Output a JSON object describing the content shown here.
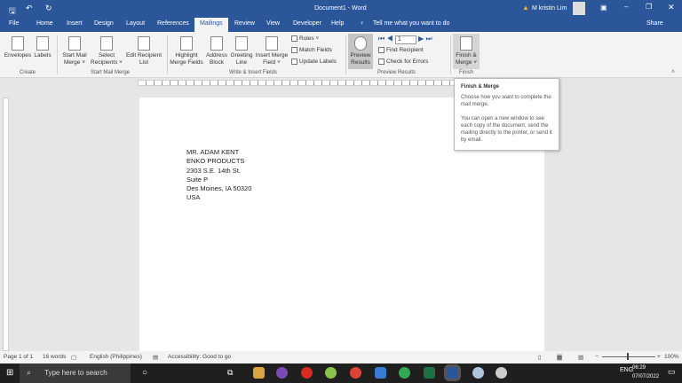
{
  "titlebar": {
    "title": "Document1  -  Word",
    "user": "M kristin Lim"
  },
  "tabs": [
    "File",
    "Home",
    "Insert",
    "Design",
    "Layout",
    "References",
    "Mailings",
    "Review",
    "View",
    "Developer",
    "Help"
  ],
  "active_tab": "Mailings",
  "tell_me": "Tell me what you want to do",
  "share": "Share",
  "ribbon": {
    "create": {
      "label": "Create",
      "envelopes": "Envelopes",
      "labels": "Labels"
    },
    "start": {
      "label": "Start Mail Merge",
      "start_mail_merge": "Start Mail Merge ˅",
      "select_recipients": "Select Recipients ˅",
      "edit_list": "Edit Recipient List"
    },
    "write": {
      "label": "Write & Insert Fields",
      "highlight": "Highlight Merge Fields",
      "address": "Address Block",
      "greeting": "Greeting Line",
      "insert_field": "Insert Merge Field ˅",
      "rules": "Rules ˅",
      "match": "Match Fields",
      "update": "Update Labels"
    },
    "preview": {
      "label": "Preview Results",
      "preview_results": "Preview Results",
      "record": "1",
      "find": "Find Recipient",
      "check": "Check for Errors"
    },
    "finish": {
      "label": "Finish",
      "finish_merge": "Finish & Merge ˅"
    }
  },
  "tooltip": {
    "title": "Finish & Merge",
    "line1": "Choose how you want to complete the mail merge.",
    "line2": "You can open a new window to see each copy of the document, send the mailing directly to the printer, or send it by email."
  },
  "document": {
    "lines": [
      "MR. ADAM KENT",
      "ENKO PRODUCTS",
      "2303 S.E. 14th St.",
      "Suite P",
      "Des Moines, IA 50320",
      "USA"
    ]
  },
  "status": {
    "page": "Page 1 of 1",
    "words": "16 words",
    "language": "English (Philippines)",
    "accessibility": "Accessibility: Good to go",
    "zoom": "100%"
  },
  "taskbar": {
    "search_placeholder": "Type here to search",
    "lang": "ENG",
    "time": "06:29",
    "date": "07/07/2022"
  },
  "colors": {
    "brand": "#2b579a",
    "taskbar": "#1f1f1f"
  }
}
